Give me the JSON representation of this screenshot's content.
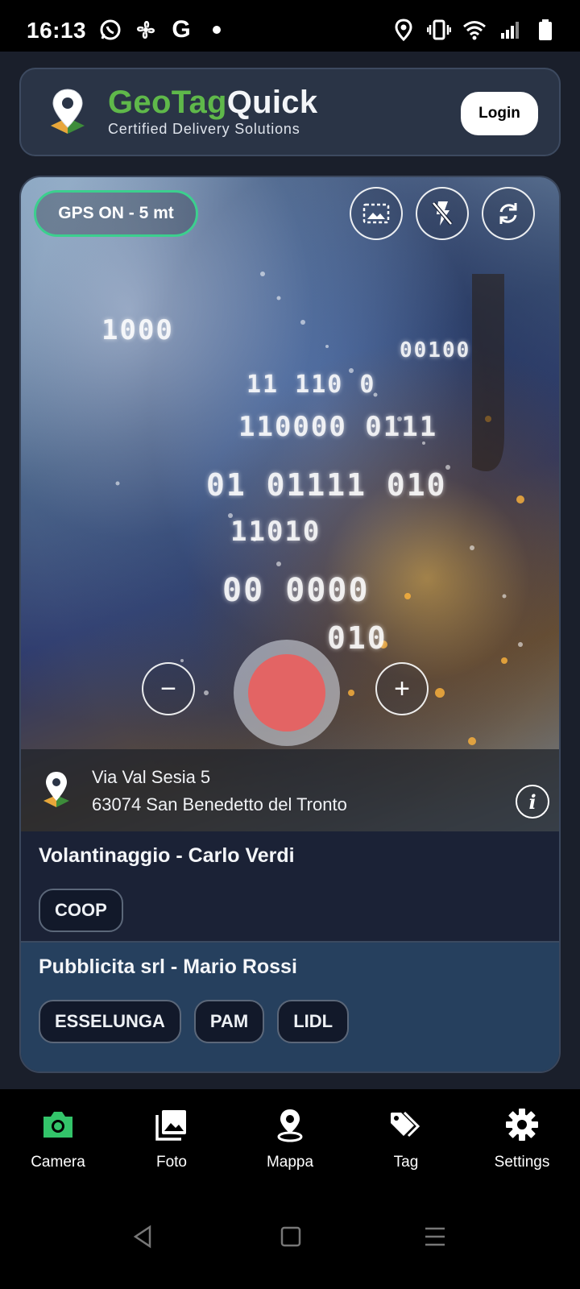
{
  "status_bar": {
    "time": "16:13",
    "left_icons": [
      "whatsapp-icon",
      "fan-icon",
      "google-icon",
      "dot-icon"
    ],
    "right_icons": [
      "location-icon",
      "vibrate-icon",
      "wifi-icon",
      "signal-icon",
      "battery-icon"
    ],
    "google_glyph": "G"
  },
  "header": {
    "brand_part1": "GeoTag",
    "brand_part2": "Quick",
    "tagline": "Certified Delivery Solutions",
    "login_label": "Login"
  },
  "camera": {
    "gps_status": "GPS ON - 5 mt",
    "zoom_out_label": "−",
    "zoom_in_label": "+",
    "address_line1": "Via Val Sesia 5",
    "address_line2": "63074 San Benedetto del Tronto",
    "info_label": "i"
  },
  "groups": [
    {
      "title": "Volantinaggio - Carlo Verdi",
      "chips": [
        "COOP"
      ]
    },
    {
      "title": "Pubblicita srl - Mario Rossi",
      "chips": [
        "ESSELUNGA",
        "PAM",
        "LIDL"
      ]
    }
  ],
  "nav": {
    "items": [
      {
        "label": "Camera",
        "icon": "camera-icon",
        "active": true
      },
      {
        "label": "Foto",
        "icon": "gallery-icon",
        "active": false
      },
      {
        "label": "Mappa",
        "icon": "map-pin-icon",
        "active": false
      },
      {
        "label": "Tag",
        "icon": "tag-icon",
        "active": false
      },
      {
        "label": "Settings",
        "icon": "gear-icon",
        "active": false
      }
    ],
    "active_color": "#33c46a"
  },
  "colors": {
    "brand_green": "#5fb84a",
    "gps_border": "#3ccf8e",
    "shutter": "#e36464"
  }
}
